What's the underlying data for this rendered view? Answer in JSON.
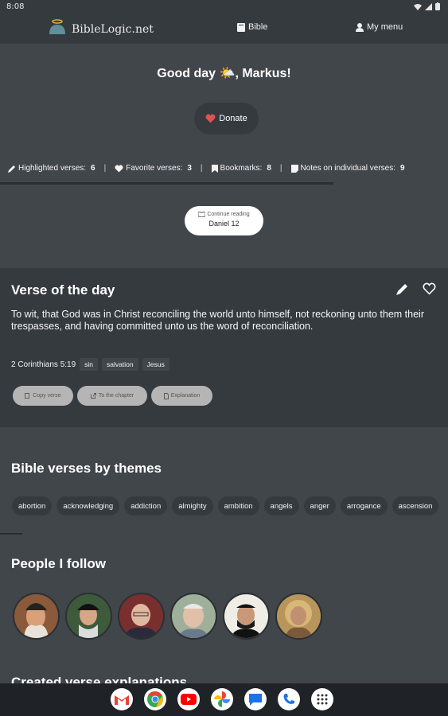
{
  "status": {
    "time": "8:08"
  },
  "header": {
    "site_name": "BibleLogic.net",
    "nav_bible": "Bible",
    "nav_menu": "My menu"
  },
  "greeting": "Good day 🌤️, Markus!",
  "donate_label": "Donate",
  "stats": {
    "highlighted_label": "Highlighted verses:",
    "highlighted_count": "6",
    "favorite_label": "Favorite verses:",
    "favorite_count": "3",
    "bookmarks_label": "Bookmarks:",
    "bookmarks_count": "8",
    "notes_label": "Notes on individual verses:",
    "notes_count": "9"
  },
  "continue_reading": {
    "label": "Continue reading",
    "location": "Daniel 12"
  },
  "verse_of_the_day": {
    "title": "Verse of the day",
    "text": "To wit, that God was in Christ reconciling the world unto himself, not reckoning unto them their trespasses, and having committed unto us the word of reconciliation.",
    "reference": "2 Corinthians 5:19",
    "tags": [
      "sin",
      "salvation",
      "Jesus"
    ],
    "actions": {
      "copy": "Copy verse",
      "chapter": "To the chapter",
      "explanation": "Explanation"
    }
  },
  "themes": {
    "title": "Bible verses by themes",
    "items": [
      "abortion",
      "acknowledging",
      "addiction",
      "almighty",
      "ambition",
      "angels",
      "anger",
      "arrogance",
      "ascension"
    ]
  },
  "people": {
    "title": "People I follow",
    "avatars": [
      "person-1",
      "person-2",
      "person-3",
      "person-4",
      "person-5",
      "person-6"
    ]
  },
  "created_title": "Created verse explanations",
  "colors": {
    "background": "#41464b",
    "panel": "#353a3f",
    "heart": "#e05252"
  },
  "dock": [
    "gmail-icon",
    "chrome-icon",
    "youtube-icon",
    "photos-icon",
    "messages-icon",
    "phone-icon",
    "app-drawer-icon"
  ]
}
